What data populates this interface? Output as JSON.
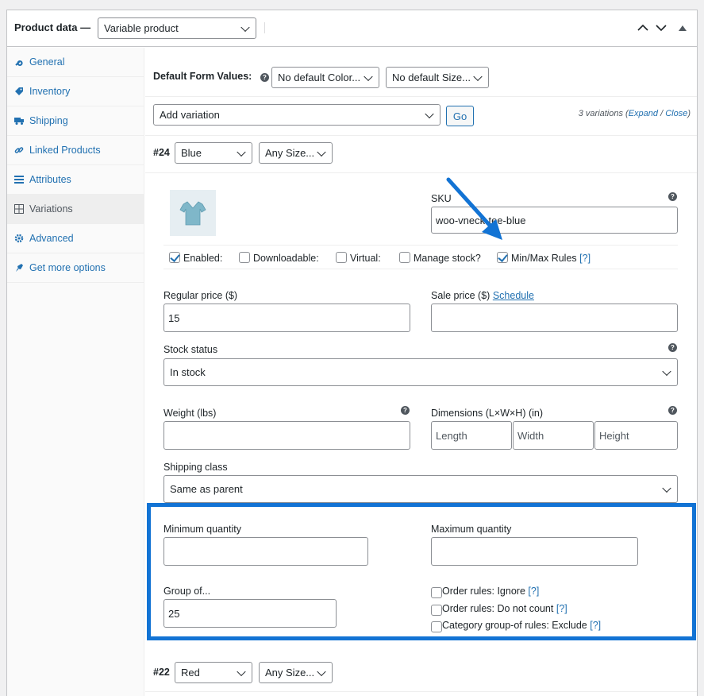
{
  "header": {
    "title": "Product data —",
    "product_type": "Variable product",
    "arrow_up": "⌃",
    "arrow_down": "⌄",
    "collapse": "▲"
  },
  "sidebar": {
    "items": [
      {
        "label": "General",
        "icon": "wrench-icon",
        "glyph": "🔧"
      },
      {
        "label": "Inventory",
        "icon": "tag-icon",
        "glyph": "◈"
      },
      {
        "label": "Shipping",
        "icon": "truck-icon",
        "glyph": "▬"
      },
      {
        "label": "Linked Products",
        "icon": "link-icon",
        "glyph": "⛓"
      },
      {
        "label": "Attributes",
        "icon": "list-icon",
        "glyph": "▤"
      },
      {
        "label": "Variations",
        "icon": "grid-icon",
        "glyph": "⊞"
      },
      {
        "label": "Advanced",
        "icon": "gear-icon",
        "glyph": "⚙"
      },
      {
        "label": "Get more options",
        "icon": "plugin-icon",
        "glyph": "✎"
      }
    ]
  },
  "defaults": {
    "label": "Default Form Values:",
    "color_select": "No default Color...",
    "size_select": "No default Size..."
  },
  "toolbar": {
    "add_variation": "Add variation",
    "go": "Go",
    "count_text": "3 variations (",
    "expand": "Expand",
    "slash": " / ",
    "close": "Close",
    "close_paren": ")"
  },
  "variation24": {
    "id": "#24",
    "color": "Blue",
    "size": "Any Size...",
    "sku_label": "SKU",
    "sku_value": "woo-vneck-tee-blue",
    "enabled": "Enabled:",
    "downloadable": "Downloadable:",
    "virtual": "Virtual:",
    "manage_stock": "Manage stock?",
    "minmax": "Min/Max Rules",
    "help_link": "[?]",
    "regular_price_label": "Regular price ($)",
    "regular_price": "15",
    "sale_price_label": "Sale price ($)",
    "schedule": "Schedule",
    "stock_status_label": "Stock status",
    "stock_status": "In stock",
    "weight_label": "Weight (lbs)",
    "dimensions_label": "Dimensions (L×W×H) (in)",
    "length_ph": "Length",
    "width_ph": "Width",
    "height_ph": "Height",
    "shipping_class_label": "Shipping class",
    "shipping_class": "Same as parent",
    "min_qty_label": "Minimum quantity",
    "max_qty_label": "Maximum quantity",
    "group_of_label": "Group of...",
    "group_of_value": "25",
    "order_rules_ignore": "Order rules: Ignore",
    "order_rules_not_count": "Order rules: Do not count",
    "category_exclude": "Category group-of rules: Exclude"
  },
  "variation22": {
    "id": "#22",
    "color": "Red",
    "size": "Any Size..."
  },
  "help_glyph": "?",
  "colors": {
    "accent": "#2271b1",
    "highlight": "#1273d4"
  }
}
